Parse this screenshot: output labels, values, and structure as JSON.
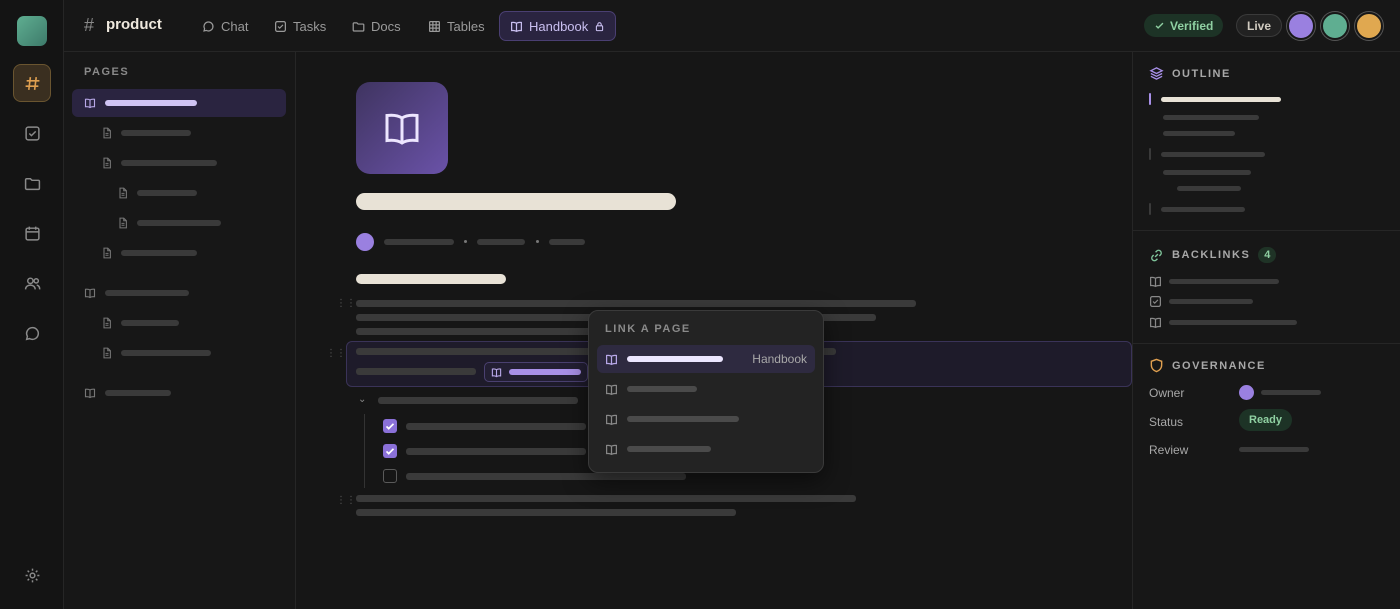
{
  "topbar": {
    "channel_name": "product",
    "tabs": [
      {
        "label": "Chat",
        "icon": "chat-bubble-icon"
      },
      {
        "label": "Tasks",
        "icon": "checkbox-icon"
      },
      {
        "label": "Docs",
        "icon": "folder-icon"
      },
      {
        "label": "Tables",
        "icon": "grid-icon"
      },
      {
        "label": "Handbook",
        "icon": "book-icon",
        "active": true,
        "locked": true
      }
    ],
    "verified_label": "Verified",
    "live_label": "Live",
    "avatars": [
      "#9a80e0",
      "#5fae91",
      "#e0a850"
    ]
  },
  "sidebar": {
    "section_label": "PAGES"
  },
  "popup": {
    "title": "LINK A PAGE",
    "first_item_tag": "Handbook"
  },
  "right_panel": {
    "outline_label": "OUTLINE",
    "backlinks_label": "BACKLINKS",
    "backlinks_count": "4",
    "governance_label": "GOVERNANCE",
    "owner_label": "Owner",
    "status_label": "Status",
    "status_value": "Ready",
    "review_label": "Review"
  },
  "colors": {
    "accent": "#8a70d8",
    "success": "#8fd0a2",
    "warning": "#e0a050"
  }
}
